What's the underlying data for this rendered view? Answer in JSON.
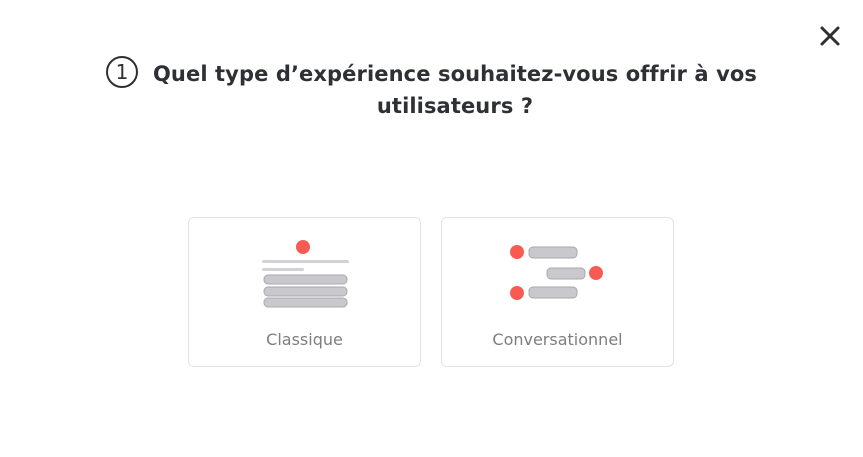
{
  "dialog": {
    "step_number": "1",
    "question": "Quel type d’expérience souhaitez-vous offrir à vos utilisateurs ?",
    "close_icon": "close-icon"
  },
  "options": [
    {
      "label": "Classique",
      "icon": "classic-form-illustration"
    },
    {
      "label": "Conversationnel",
      "icon": "conversational-form-illustration"
    }
  ],
  "colors": {
    "accent": "#f95b53",
    "bar": "#c8c8cd",
    "bar_border": "#a8a8ae",
    "text_dark": "#2f3034",
    "text_muted": "#7d7d83",
    "card_border": "#e3e3e6"
  }
}
